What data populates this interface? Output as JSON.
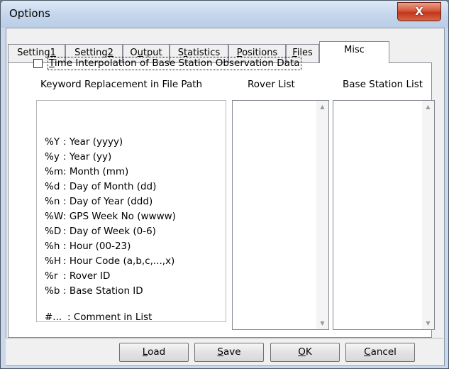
{
  "window": {
    "title": "Options",
    "close_glyph": "X"
  },
  "tabs": [
    {
      "pre": "Setting",
      "acc": "1",
      "post": ""
    },
    {
      "pre": "Setting",
      "acc": "2",
      "post": ""
    },
    {
      "pre": "O",
      "acc": "u",
      "post": "tput"
    },
    {
      "pre": "S",
      "acc": "t",
      "post": "atistics"
    },
    {
      "pre": "",
      "acc": "P",
      "post": "ositions"
    },
    {
      "pre": "",
      "acc": "F",
      "post": "iles"
    },
    {
      "pre": "Misc",
      "acc": "",
      "post": ""
    }
  ],
  "misc": {
    "time_interp": {
      "checked": false,
      "pre": "",
      "acc": "T",
      "post": "ime Interpolation of Base Station Observation Data"
    },
    "keyword_title": "Keyword Replacement in File Path",
    "rover_list_label": "Rover List",
    "base_list_label": "Base Station List",
    "keywords": [
      {
        "key": "%Y",
        "desc": ": Year (yyyy)"
      },
      {
        "key": "%y",
        "desc": ": Year (yy)"
      },
      {
        "key": "%m",
        "desc": ": Month (mm)"
      },
      {
        "key": "%d",
        "desc": ": Day of Month (dd)"
      },
      {
        "key": "%n",
        "desc": ": Day of Year (ddd)"
      },
      {
        "key": "%W",
        "desc": ": GPS Week No (wwww)"
      },
      {
        "key": "%D",
        "desc": ": Day of Week (0-6)"
      },
      {
        "key": "%h",
        "desc": ": Hour (00-23)"
      },
      {
        "key": "%H",
        "desc": ": Hour Code (a,b,c,...,x)"
      },
      {
        "key": "%r",
        "desc": ": Rover ID"
      },
      {
        "key": "%b",
        "desc": ": Base Station ID"
      }
    ],
    "comment": {
      "key": "#...",
      "desc": ": Comment in List"
    }
  },
  "buttons": [
    {
      "pre": "",
      "acc": "L",
      "post": "oad"
    },
    {
      "pre": "",
      "acc": "S",
      "post": "ave"
    },
    {
      "pre": "",
      "acc": "O",
      "post": "K"
    },
    {
      "pre": "",
      "acc": "C",
      "post": "ancel"
    }
  ],
  "icons": {
    "scroll_up": "▲",
    "scroll_down": "▼"
  }
}
